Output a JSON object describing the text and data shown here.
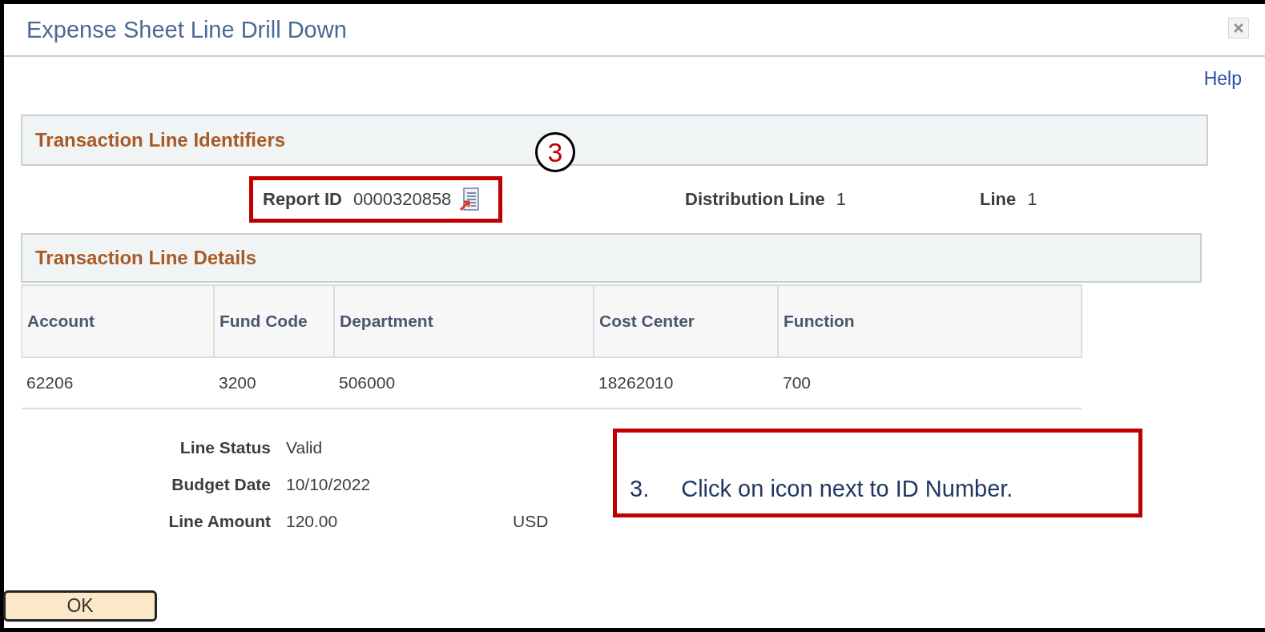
{
  "dialog": {
    "title": "Expense Sheet Line Drill Down",
    "help_link": "Help"
  },
  "identifiers": {
    "heading": "Transaction Line Identifiers",
    "fields": [
      {
        "label": "Report ID",
        "value": "0000320858",
        "kind": "lookup",
        "highlighted": true
      },
      {
        "label": "Distribution Line",
        "value": "1",
        "kind": "plain",
        "highlighted": false
      },
      {
        "label": "Line",
        "value": "1",
        "kind": "plain",
        "highlighted": false
      }
    ]
  },
  "details": {
    "heading": "Transaction Line Details",
    "table": {
      "columns": [
        "Account",
        "Fund Code",
        "Department",
        "Cost Center",
        "Function"
      ],
      "rows": [
        [
          "62206",
          "3200",
          "506000",
          "18262010",
          "700"
        ]
      ]
    }
  },
  "summary": [
    {
      "label": "Line Status",
      "value": "Valid"
    },
    {
      "label": "Budget Date",
      "value": "10/10/2022"
    },
    {
      "label": "Line Amount",
      "value": "120.00",
      "currency": "USD"
    }
  ],
  "ok_button": "OK",
  "annotation": {
    "marker": "3",
    "step_number": "3.",
    "step_text": "Click on icon next to ID Number."
  }
}
